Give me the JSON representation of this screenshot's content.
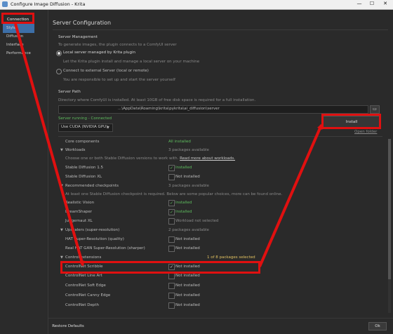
{
  "window": {
    "title": "Configure Image Diffusion - Krita",
    "controls": [
      "—",
      "☐",
      "✕"
    ]
  },
  "sidebar": {
    "items": [
      {
        "label": "Connection"
      },
      {
        "label": "Styles"
      },
      {
        "label": "Diffusion"
      },
      {
        "label": "Interface"
      },
      {
        "label": "Performance"
      }
    ]
  },
  "main": {
    "heading": "Server Configuration",
    "server_management": {
      "title": "Server Management",
      "intro": "To generate images, the plugin connects to a ComfyUI server",
      "local": {
        "label": "Local server managed by Krita plugin",
        "desc": "Let the Krita plugin install and manage a local server on your machine",
        "selected": true
      },
      "external": {
        "label": "Connect to external Server (local or remote)",
        "desc": "You are responsible to set up and start the server yourself",
        "selected": false
      }
    },
    "server_path": {
      "title": "Server Path",
      "desc": "Directory where ComfyUI is installed. At least 10GB of free disk space is required for a full installation.",
      "value": "...\\AppData\\Roaming\\krita\\pykrita\\ai_diffusion\\server",
      "browse_icon": "folder-icon"
    },
    "status": "Server running - Connected",
    "backend": "Use CUDA (NVIDIA GPU)",
    "install_button": "Install",
    "open_folder": "Open folder",
    "packages": {
      "core": {
        "label": "Core components",
        "status": "All installed"
      },
      "workloads": {
        "label": "Workloads",
        "status": "3 packages available",
        "desc_prefix": "Choose one or both Stable Diffusion versions to work with.",
        "desc_link": "Read more about workloads.",
        "items": [
          {
            "label": "Stable Diffusion 1.5",
            "status": "Installed",
            "checked": true
          },
          {
            "label": "Stable Diffusion XL",
            "status": "Not installed",
            "checked": false
          }
        ]
      },
      "checkpoints": {
        "label": "Recommended checkpoints",
        "status": "3 packages available",
        "desc": "At least one Stable Diffusion checkpoint is required. Below are some popular choices, more can be found online.",
        "items": [
          {
            "label": "Realistic Vision",
            "status": "Installed",
            "checked": true
          },
          {
            "label": "DreamShaper",
            "status": "Installed",
            "checked": true
          },
          {
            "label": "Juggernaut XL",
            "status": "Workload not selected",
            "checked": false
          }
        ]
      },
      "upscalers": {
        "label": "Upscalers (super-resolution)",
        "status": "2 packages available",
        "items": [
          {
            "label": "HAT Super-Resolution (quality)",
            "status": "Not installed",
            "checked": false
          },
          {
            "label": "Real HAT GAN Super-Resolution (sharper)",
            "status": "Not installed",
            "checked": false
          }
        ]
      },
      "control": {
        "label": "Control extensions",
        "status": "1 of 8 packages selected",
        "items": [
          {
            "label": "ControlNet Scribble",
            "status": "Not installed",
            "checked": true
          },
          {
            "label": "ControlNet Line Art",
            "status": "Not installed",
            "checked": false
          },
          {
            "label": "ControlNet Soft Edge",
            "status": "Not installed",
            "checked": false
          },
          {
            "label": "ControlNet Canny Edge",
            "status": "Not installed",
            "checked": false
          },
          {
            "label": "ControlNet Depth",
            "status": "Not installed",
            "checked": false
          }
        ]
      }
    },
    "footer": {
      "restore": "Restore Defaults",
      "ok": "Ok"
    }
  },
  "colors": {
    "annotation": "#e01010",
    "accent": "#3d6fa8",
    "installed": "#5fbf5f"
  }
}
